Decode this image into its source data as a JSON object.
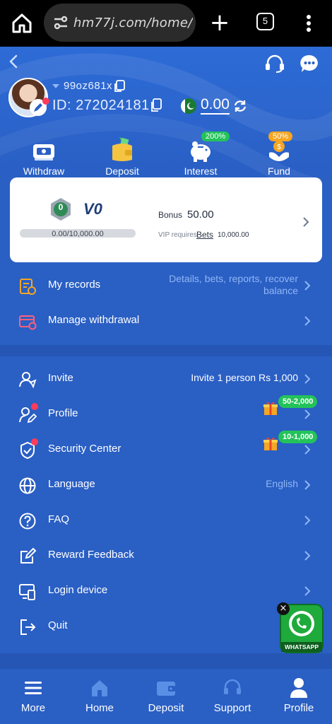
{
  "browser": {
    "url": "hm77j.com/home/",
    "tab_count": "5"
  },
  "header": {
    "username": "99oz681x",
    "user_id": "ID: 272024181",
    "balance": "0.00"
  },
  "quick_actions": [
    {
      "label": "Withdraw",
      "icon": "withdraw-icon"
    },
    {
      "label": "Deposit",
      "icon": "wallet-icon"
    },
    {
      "label": "Interest",
      "icon": "piggy-bank-icon",
      "badge": "200%"
    },
    {
      "label": "Fund",
      "icon": "fund-icon",
      "badge": "50%"
    }
  ],
  "vip": {
    "medal": "0",
    "level": "V0",
    "progress_text": "0.00/10,000.00",
    "progress_fraction": 0.0,
    "bonus_label": "Bonus",
    "bonus_value": "50.00",
    "requires_label": "VIP requires",
    "bets_label": "Bets",
    "bets_amount": "10,000.00"
  },
  "records": {
    "my_records": "My records",
    "my_records_detail": "Details, bets, reports, recover balance",
    "manage_withdrawal": "Manage withdrawal"
  },
  "menu": {
    "invite": "Invite",
    "invite_value": "Invite 1 person Rs 1,000",
    "profile": "Profile",
    "profile_badge": "50-2,000",
    "security": "Security Center",
    "security_badge": "10-1,000",
    "language": "Language",
    "language_value": "English",
    "faq": "FAQ",
    "reward_feedback": "Reward Feedback",
    "login_device": "Login device",
    "quit": "Quit"
  },
  "whatsapp": {
    "label": "WHATSAPP"
  },
  "bottom_nav": [
    {
      "label": "More",
      "icon": "menu-icon"
    },
    {
      "label": "Home",
      "icon": "home-icon"
    },
    {
      "label": "Deposit",
      "icon": "wallet-icon"
    },
    {
      "label": "Support",
      "icon": "headset-icon"
    },
    {
      "label": "Profile",
      "icon": "person-icon"
    }
  ],
  "colors": {
    "primary": "#2a5fc4",
    "accent_light": "#8fb6f5",
    "badge_green": "#23c35a",
    "alert_red": "#ff3b5c"
  }
}
